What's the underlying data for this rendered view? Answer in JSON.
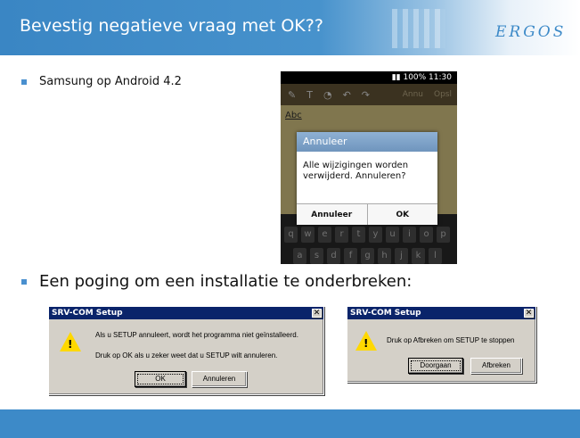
{
  "header": {
    "title": "Bevestig negatieve vraag met OK??",
    "logo": "ERGOS"
  },
  "bullets": [
    "Samsung op Android 4.2",
    "Een poging om een installatie te onderbreken:"
  ],
  "phone": {
    "status": "100% 11:30",
    "toolbar": {
      "cancel": "Annu",
      "save": "Opsl"
    },
    "note_text": "Abc",
    "dialog": {
      "title": "Annuleer",
      "message_line1": "Alle wijzigingen worden",
      "message_line2": "verwijderd. Annuleren?",
      "cancel_button": "Annuleer",
      "ok_button": "OK"
    },
    "keyboard_row1": [
      "q",
      "w",
      "e",
      "r",
      "t",
      "y",
      "u",
      "i",
      "o",
      "p"
    ],
    "keyboard_row2": [
      "a",
      "s",
      "d",
      "f",
      "g",
      "h",
      "j",
      "k",
      "l"
    ]
  },
  "win_dialog_1": {
    "title": "SRV-COM Setup",
    "line1": "Als u SETUP annuleert, wordt het programma niet geïnstalleerd.",
    "line2": "Druk op OK als u zeker weet dat u SETUP wilt annuleren.",
    "ok_button": "OK",
    "cancel_button": "Annuleren"
  },
  "win_dialog_2": {
    "title": "SRV-COM Setup",
    "line1": "Druk op Afbreken om SETUP te stoppen",
    "continue_button": "Doorgaan",
    "abort_button": "Afbreken"
  },
  "colors": {
    "accent": "#3d8ac8",
    "titlebar": "#0a246a",
    "warning": "#ffd800"
  }
}
